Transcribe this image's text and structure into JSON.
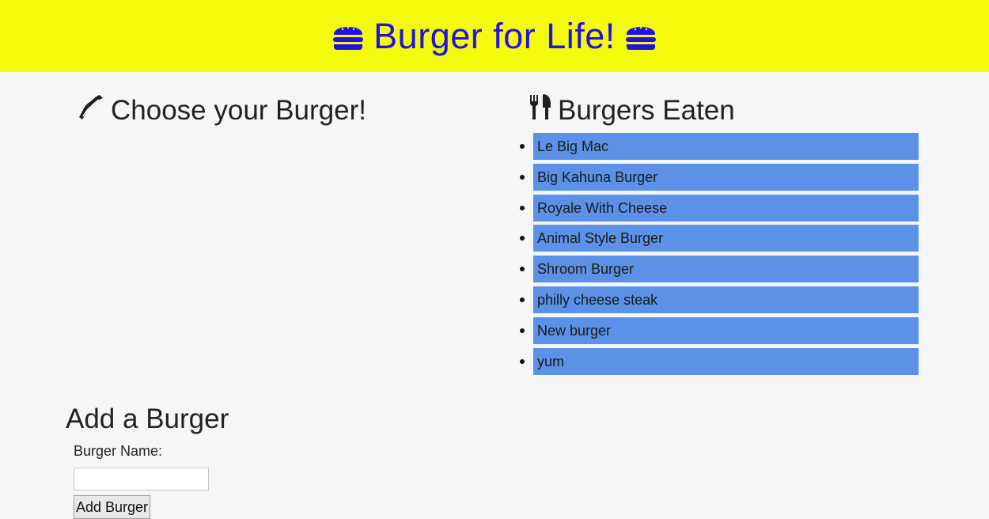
{
  "header": {
    "title": "Burger for Life!",
    "icon": "hamburger-icon",
    "background": "#f4fa0c",
    "text_color": "#2410e6"
  },
  "choose": {
    "heading": "Choose your Burger!",
    "icon": "bacon-icon"
  },
  "eaten": {
    "heading": "Burgers Eaten",
    "icon": "utensils-icon",
    "item_color": "#5b91e6",
    "items": [
      "Le Big Mac",
      "Big Kahuna Burger",
      "Royale With Cheese",
      "Animal Style Burger",
      "Shroom Burger",
      "philly cheese steak",
      "New burger",
      "yum"
    ]
  },
  "add_form": {
    "heading": "Add a Burger",
    "name_label": "Burger Name:",
    "name_value": "",
    "submit_label": "Add Burger"
  }
}
